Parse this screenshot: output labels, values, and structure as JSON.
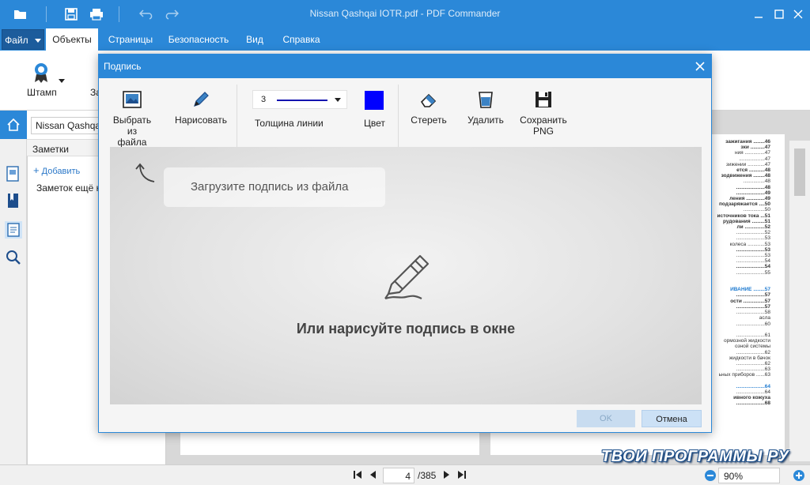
{
  "window": {
    "title": "Nissan Qashqai IOTR.pdf - PDF Commander"
  },
  "menu": {
    "file": "Файл",
    "tabs": [
      "Объекты",
      "Страницы",
      "Безопасность",
      "Вид",
      "Справка"
    ]
  },
  "ribbon": {
    "stamp_label": "Штамп",
    "cut_label": "За"
  },
  "notes_panel": {
    "search_value": "Nissan Qashqai I",
    "header": "Заметки",
    "add_label": "Добавить",
    "empty_text": "Заметок ещё не"
  },
  "dialog": {
    "title": "Подпись",
    "tools": {
      "choose_file": [
        "Выбрать",
        "из файла"
      ],
      "draw": "Нарисовать",
      "line_thickness_value": "3",
      "line_thickness_label": "Толщина линии",
      "color_label": "Цвет",
      "erase": "Стереть",
      "delete": "Удалить",
      "save_png": [
        "Сохранить",
        "PNG"
      ]
    },
    "color": "#0000ff",
    "upload_hint": "Загрузите подпись из файла",
    "draw_hint": "Или нарисуйте подпись в окне",
    "ok_label": "OK",
    "cancel_label": "Отмена"
  },
  "toc": [
    {
      "t": "зажигания ........46",
      "s": "b"
    },
    {
      "t": "зки ..........47",
      "s": "b"
    },
    {
      "t": "ния ..............47",
      "s": ""
    },
    {
      "t": "..................47",
      "s": ""
    },
    {
      "t": "зижении ............47",
      "s": ""
    },
    {
      "t": "ется ...........48",
      "s": "b"
    },
    {
      "t": "зодвижения ........48",
      "s": "b"
    },
    {
      "t": "...............48",
      "s": ""
    },
    {
      "t": "....................48",
      "s": "b"
    },
    {
      "t": "....................49",
      "s": "b"
    },
    {
      "t": "ления .............49",
      "s": "b"
    },
    {
      "t": "подзаряжается ....50",
      "s": "b"
    },
    {
      "t": "...............50",
      "s": ""
    },
    {
      "t": "источников тока ...51",
      "s": "b"
    },
    {
      "t": "рудования .........51",
      "s": "b"
    },
    {
      "t": "ли ..............52",
      "s": "b"
    },
    {
      "t": "....................52",
      "s": ""
    },
    {
      "t": "....................53",
      "s": ""
    },
    {
      "t": "колеса ............53",
      "s": ""
    },
    {
      "t": "....................53",
      "s": "b"
    },
    {
      "t": "....................53",
      "s": ""
    },
    {
      "t": "....................54",
      "s": ""
    },
    {
      "t": "....................54",
      "s": "b"
    },
    {
      "t": "....................55",
      "s": ""
    },
    {
      "t": "",
      "s": ""
    },
    {
      "t": "",
      "s": ""
    },
    {
      "t": "ИВАНИЕ ........57",
      "s": "blue"
    },
    {
      "t": "....................57",
      "s": "b"
    },
    {
      "t": "ости ...............57",
      "s": "b"
    },
    {
      "t": "....................57",
      "s": "b"
    },
    {
      "t": "....................58",
      "s": ""
    },
    {
      "t": "асла",
      "s": ""
    },
    {
      "t": "....................60",
      "s": ""
    },
    {
      "t": "",
      "s": ""
    },
    {
      "t": "....................61",
      "s": ""
    },
    {
      "t": "ормозной жидкости",
      "s": ""
    },
    {
      "t": "озной системы",
      "s": ""
    },
    {
      "t": "....................62",
      "s": ""
    },
    {
      "t": "жидкости в бачок",
      "s": ""
    },
    {
      "t": "....................62",
      "s": ""
    },
    {
      "t": "....................63",
      "s": ""
    },
    {
      "t": "ьных приборов ......63",
      "s": ""
    },
    {
      "t": "",
      "s": ""
    },
    {
      "t": "....................64",
      "s": "blue"
    },
    {
      "t": "....................64",
      "s": ""
    },
    {
      "t": "ивного кожуха",
      "s": "b"
    },
    {
      "t": "....................68",
      "s": "b"
    }
  ],
  "status": {
    "page": "4",
    "total": "/385",
    "zoom": "90%"
  },
  "watermark": "ТВОИ ПРОГРАММЫ РУ"
}
